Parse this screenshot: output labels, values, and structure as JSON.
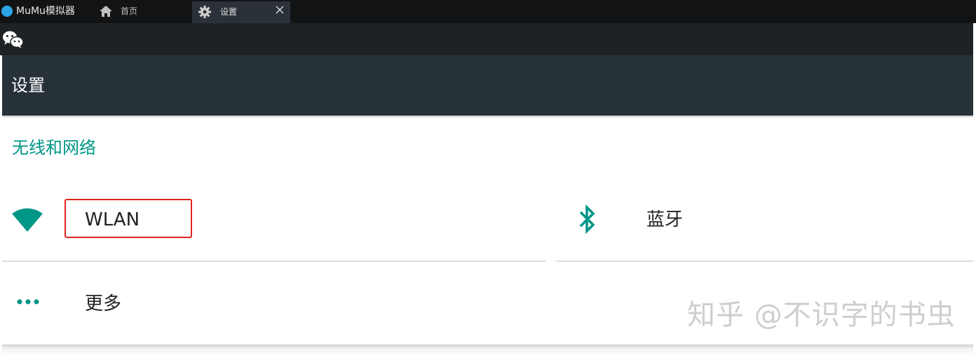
{
  "window": {
    "app_name": "MuMu模拟器",
    "tabs": [
      {
        "label": "首页",
        "icon": "home-icon",
        "active": false
      },
      {
        "label": "设置",
        "icon": "gear-icon",
        "active": true,
        "close_icon": "close-icon"
      }
    ]
  },
  "toolbar": {
    "icon": "wechat-icon"
  },
  "appbar": {
    "title": "设置"
  },
  "content": {
    "section_header": "无线和网络",
    "items": [
      {
        "label": "WLAN",
        "icon": "wifi-icon",
        "highlighted": true
      },
      {
        "label": "蓝牙",
        "icon": "bluetooth-icon"
      },
      {
        "label": "更多",
        "icon": "more-dots-icon"
      }
    ]
  },
  "watermark": "知乎 @不识字的书虫",
  "colors": {
    "titlebar": "#121314",
    "toolbar": "#1e2225",
    "appbar": "#263238",
    "accent": "#009688",
    "highlight_box": "#e0241b"
  }
}
